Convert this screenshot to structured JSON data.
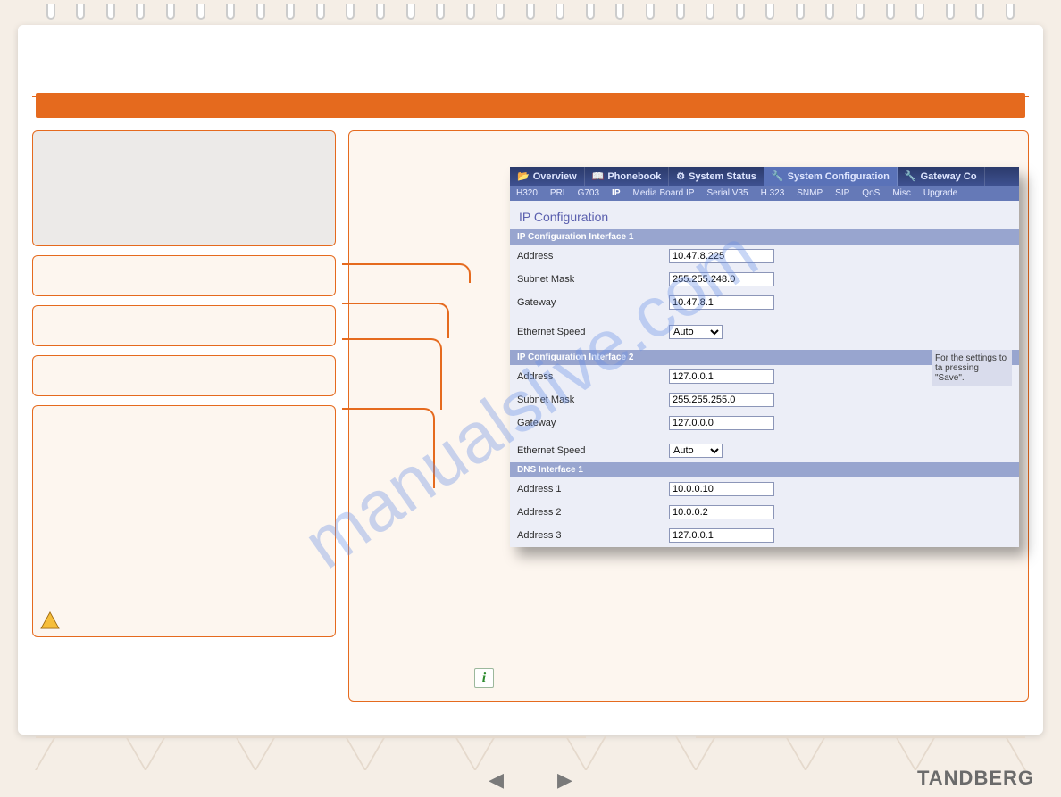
{
  "watermark": "manualslive.com",
  "brand": "TANDBERG",
  "shot": {
    "tabs": [
      "Overview",
      "Phonebook",
      "System Status",
      "System Configuration",
      "Gateway Co"
    ],
    "tabs_active_index": 3,
    "subtabs": [
      "H320",
      "PRI",
      "G703",
      "IP",
      "Media Board IP",
      "Serial V35",
      "H.323",
      "SNMP",
      "SIP",
      "QoS",
      "Misc",
      "Upgrade"
    ],
    "subtabs_active_index": 3,
    "title": "IP Configuration",
    "note": "For the settings to ta pressing \"Save\".",
    "sections": {
      "if1": {
        "header": "IP Configuration Interface 1",
        "address_label": "Address",
        "address": "10.47.8.225",
        "subnet_label": "Subnet Mask",
        "subnet": "255.255.248.0",
        "gateway_label": "Gateway",
        "gateway": "10.47.8.1",
        "speed_label": "Ethernet Speed",
        "speed": "Auto"
      },
      "if2": {
        "header": "IP Configuration Interface 2",
        "address_label": "Address",
        "address": "127.0.0.1",
        "subnet_label": "Subnet Mask",
        "subnet": "255.255.255.0",
        "gateway_label": "Gateway",
        "gateway": "127.0.0.0",
        "speed_label": "Ethernet Speed",
        "speed": "Auto"
      },
      "dns": {
        "header": "DNS Interface 1",
        "addr1_label": "Address 1",
        "addr1": "10.0.0.10",
        "addr2_label": "Address 2",
        "addr2": "10.0.0.2",
        "addr3_label": "Address 3",
        "addr3": "127.0.0.1"
      }
    }
  }
}
